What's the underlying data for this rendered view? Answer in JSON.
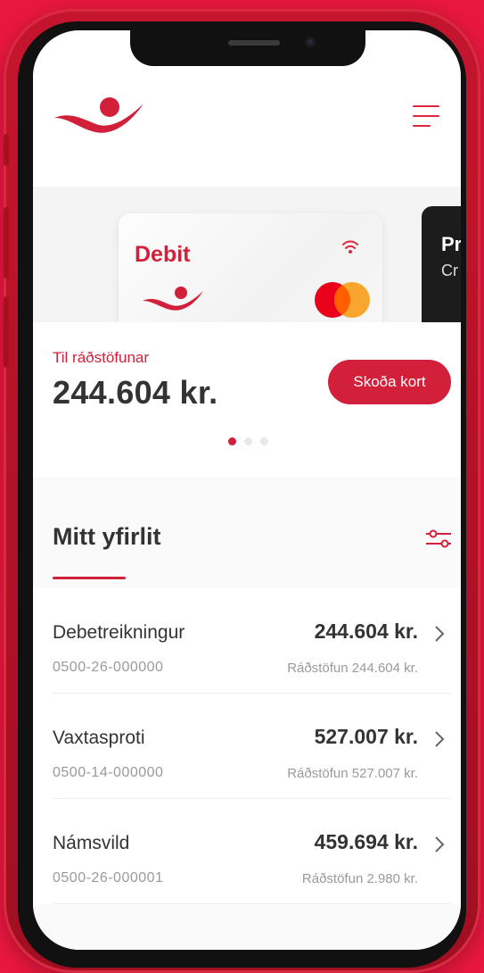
{
  "card_carousel": {
    "active_card": {
      "title": "Debit"
    },
    "next_card": {
      "title": "Pr",
      "subtitle": "Cr"
    },
    "slide_count": 3,
    "active_index": 0
  },
  "balance": {
    "label": "Til ráðstöfunar",
    "amount": "244.604 kr.",
    "view_card_label": "Skoða kort"
  },
  "overview": {
    "title": "Mitt yfirlit",
    "accounts": [
      {
        "name": "Debetreikningur",
        "balance": "244.604 kr.",
        "number": "0500-26-000000",
        "available": "Ráðstöfun 244.604 kr."
      },
      {
        "name": "Vaxtasproti",
        "balance": "527.007 kr.",
        "number": "0500-14-000000",
        "available": "Ráðstöfun 527.007 kr."
      },
      {
        "name": "Námsvild",
        "balance": "459.694 kr.",
        "number": "0500-26-000001",
        "available": "Ráðstöfun 2.980 kr."
      }
    ]
  },
  "icons": {
    "menu": "hamburger-menu-icon",
    "filter": "filter-sliders-icon",
    "nfc": "contactless-icon",
    "card_network": "mastercard-icon",
    "chevron": "chevron-right-icon"
  },
  "colors": {
    "brand_red": "#d3203a",
    "background": "#e8173f",
    "phone_frame": "#b5122a",
    "text_dark": "#333333",
    "text_muted": "#9a9a9a",
    "mastercard_red": "#eb001b",
    "mastercard_orange": "#f79e1b"
  }
}
